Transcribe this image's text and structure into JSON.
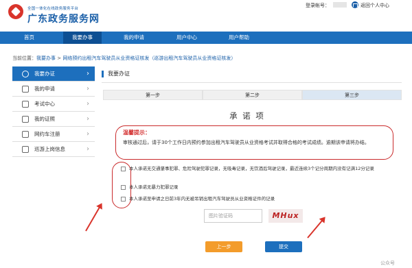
{
  "header": {
    "logo_sub": "全国一体化在线政务服务平台",
    "logo_title": "广东政务服务网",
    "account_label": "登录帐号：",
    "return_label": "返回个人中心"
  },
  "nav": {
    "items": [
      "首页",
      "我要办事",
      "我的申请",
      "用户中心",
      "用户帮助"
    ]
  },
  "breadcrumb": {
    "prefix": "当前位置：",
    "level1": "我要办事",
    "sep": " > ",
    "level2": "网络预约出租汽车驾驶员从业资格证核发（巡游出租汽车驾驶员从业资格证核发）"
  },
  "sidebar": {
    "items": [
      "我要办证",
      "我的申请",
      "考试中心",
      "我的证照",
      "网约车注册",
      "巡游上岗信息"
    ]
  },
  "main": {
    "section_title": "我要办证",
    "steps": [
      "第一步",
      "第二步",
      "第三步"
    ],
    "commit_title": "承 诺 项",
    "tip_heading": "温馨提示：",
    "tip_body": "审核通过后，请于30个工作日内预约参加出租汽车驾驶员从业资格考试并取得合格的考试成绩。逾期该申请将办结。",
    "statements": [
      "本人承诺无交通肇事犯罪、危险驾驶犯罪记录，无吸毒记录，无饮酒后驾驶记录，最近连续3个记分周期内没有记满12分记录",
      "本人承诺无暴力犯罪记录",
      "本人承诺至申请之日前3年内无被吊销出租汽车驾驶员从业资格证件的记录"
    ],
    "captcha_placeholder": "图片验证码",
    "captcha_text": "MHux",
    "prev_label": "上一步",
    "submit_label": "提交"
  },
  "watermark": "公众号",
  "colors": {
    "brand_blue": "#1d6fbd",
    "annotation_red": "#c9292a",
    "prev_orange": "#f39c2b"
  }
}
